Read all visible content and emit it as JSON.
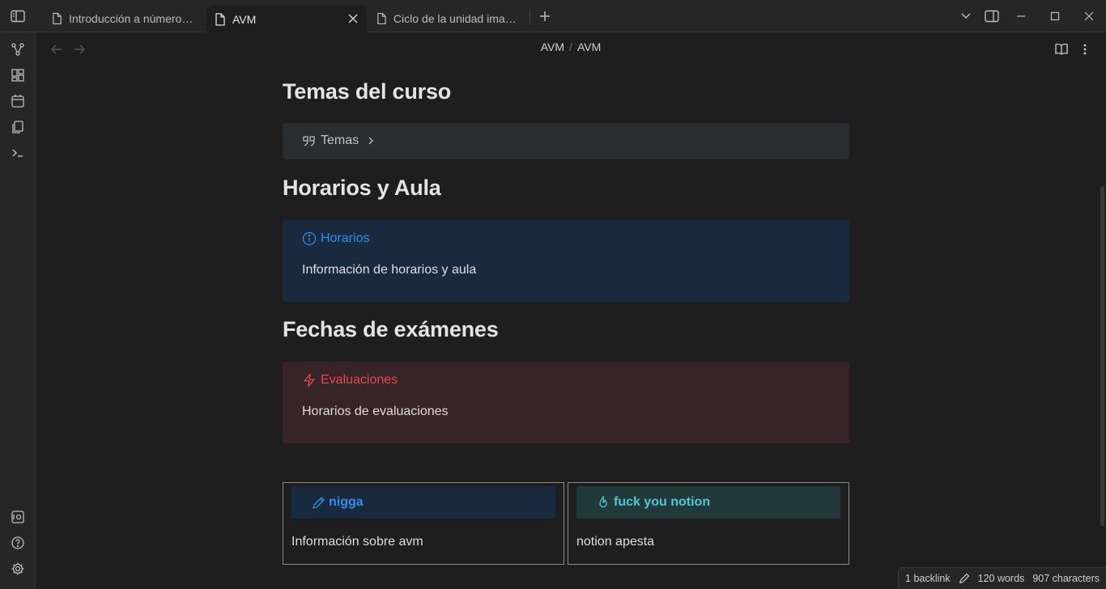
{
  "tabs": [
    {
      "label": "Introducción a números c...",
      "icon": "file-icon",
      "active": false
    },
    {
      "label": "AVM",
      "icon": "file-icon",
      "active": true
    },
    {
      "label": "Ciclo de la unidad imagin...",
      "icon": "file-icon",
      "active": false
    }
  ],
  "breadcrumb": {
    "folder": "AVM",
    "separator": "/",
    "file": "AVM"
  },
  "sections": {
    "temas": {
      "heading": "Temas del curso",
      "callout_title": "Temas"
    },
    "horarios": {
      "heading": "Horarios y Aula",
      "callout_title": "Horarios",
      "callout_body": "Información de horarios y aula"
    },
    "fechas": {
      "heading": "Fechas de exámenes",
      "callout_title": "Evaluaciones",
      "callout_body": "Horarios de evaluaciones"
    }
  },
  "columns": [
    {
      "title": "nigga",
      "body": "Información sobre avm",
      "icon": "pencil-icon"
    },
    {
      "title": "fuck you notion",
      "body": "notion apesta",
      "icon": "flame-icon"
    }
  ],
  "status": {
    "backlinks": "1 backlink",
    "words": "120 words",
    "characters": "907 characters"
  },
  "colors": {
    "info_accent": "#2e8fea",
    "info_bg": "#1a2a3e",
    "danger_accent": "#e5484d",
    "danger_bg": "#372429",
    "quote_bg": "#2a2d2f",
    "tip_accent": "#52c7cf",
    "tip_bg": "#21393b"
  }
}
